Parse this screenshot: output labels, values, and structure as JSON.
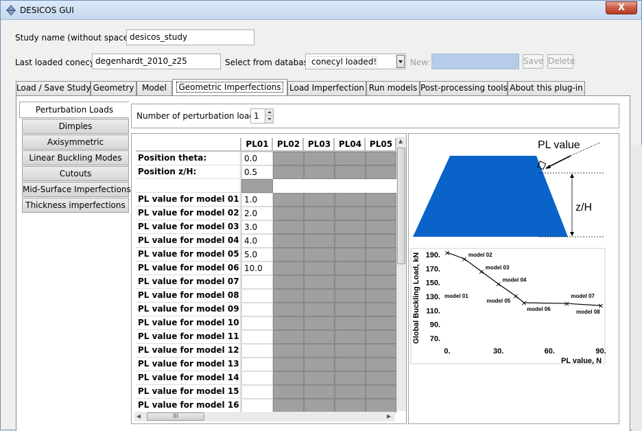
{
  "window": {
    "title": "DESICOS GUI",
    "close_glyph": "X"
  },
  "study": {
    "label": "Study name (without spaces):",
    "value": "desicos_study"
  },
  "conecyl": {
    "label": "Last loaded conecyl:",
    "value": "degenhardt_2010_z25",
    "db_label": "Select from database:",
    "db_value": "conecyl loaded!",
    "new_label": "New:",
    "save_label": "Save",
    "delete_label": "Delete"
  },
  "tabs": [
    "Load / Save Study",
    "Geometry",
    "Model",
    "Geometric Imperfections",
    "Load Imperfection",
    "Run models",
    "Post-processing tools",
    "About this plug-in"
  ],
  "active_tab": "Geometric Imperfections",
  "side_tabs": [
    "Perturbation Loads",
    "Dimples",
    "Axisymmetric",
    "Linear Buckling Modes",
    "Cutouts",
    "Mid-Surface Imperfections",
    "Thickness imperfections"
  ],
  "npl": {
    "label": "Number of perturbation loads:",
    "value": "1"
  },
  "table": {
    "columns": [
      "PL01",
      "PL02",
      "PL03",
      "PL04",
      "PL05"
    ],
    "rows": [
      {
        "label": "Position theta:",
        "value": "0.0"
      },
      {
        "label": "Position z/H:",
        "value": "0.5"
      },
      {
        "label": "",
        "value": "",
        "blank": true
      },
      {
        "label": "PL value for model 01",
        "value": "1.0"
      },
      {
        "label": "PL value for model 02",
        "value": "2.0"
      },
      {
        "label": "PL value for model 03",
        "value": "3.0"
      },
      {
        "label": "PL value for model 04",
        "value": "4.0"
      },
      {
        "label": "PL value for model 05",
        "value": "5.0"
      },
      {
        "label": "PL value for model 06",
        "value": "10.0"
      },
      {
        "label": "PL value for model 07",
        "value": ""
      },
      {
        "label": "PL value for model 08",
        "value": ""
      },
      {
        "label": "PL value for model 09",
        "value": ""
      },
      {
        "label": "PL value for model 10",
        "value": ""
      },
      {
        "label": "PL value for model 11",
        "value": ""
      },
      {
        "label": "PL value for model 12",
        "value": ""
      },
      {
        "label": "PL value for model 13",
        "value": ""
      },
      {
        "label": "PL value for model 14",
        "value": ""
      },
      {
        "label": "PL value for model 15",
        "value": ""
      },
      {
        "label": "PL value for model 16",
        "value": ""
      }
    ],
    "hscroll_grip": "III"
  },
  "figure": {
    "pl_value_label": "PL value",
    "zh_label": "z/H",
    "shape_color": "#0a63c9",
    "chart": {
      "ylabel": "Global Buckling Load, kN",
      "xlabel": "PL value, N",
      "yticks": [
        "190.",
        "170.",
        "150.",
        "130.",
        "110.",
        "90.",
        "70."
      ],
      "xticks": [
        "0.",
        "30.",
        "60.",
        "90."
      ],
      "points": [
        {
          "x": 0,
          "y": 193
        },
        {
          "x": 10,
          "y": 184
        },
        {
          "x": 20,
          "y": 166
        },
        {
          "x": 30,
          "y": 148
        },
        {
          "x": 40,
          "y": 131
        },
        {
          "x": 45,
          "y": 121
        },
        {
          "x": 70,
          "y": 120
        },
        {
          "x": 90,
          "y": 117
        }
      ],
      "point_labels": [
        "",
        "model 02",
        "model 03",
        "model 04",
        "model 05",
        "model 06",
        "model 07",
        "model 08"
      ],
      "extra_label": "model 01",
      "marker": "×"
    }
  }
}
